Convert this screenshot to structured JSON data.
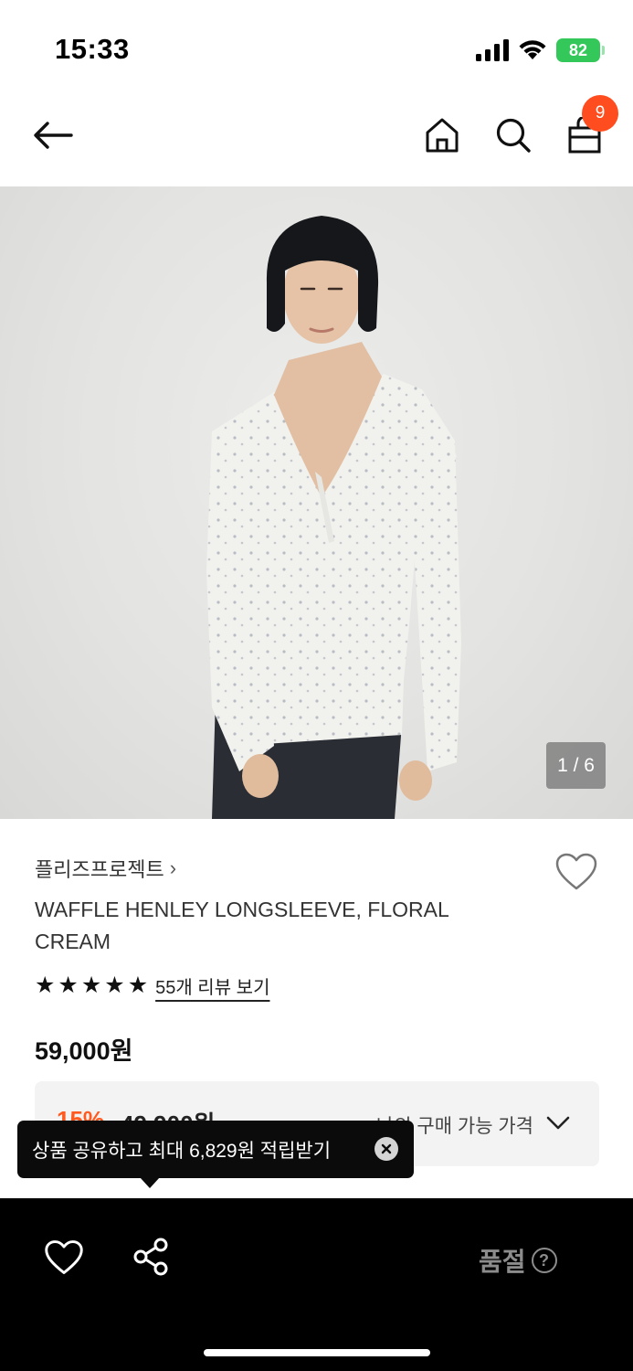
{
  "status_bar": {
    "time": "15:33",
    "battery": "82"
  },
  "nav": {
    "cart_count": "9"
  },
  "gallery": {
    "counter": "1 / 6"
  },
  "product": {
    "brand": "플리즈프로젝트",
    "brand_chevron": "›",
    "name": "WAFFLE HENLEY LONGSLEEVE, FLORAL CREAM",
    "rating_stars": 5,
    "review_link": "55개 리뷰 보기",
    "price": "59,000원"
  },
  "my_price": {
    "discount": "15%",
    "price": "49,900원",
    "label": "나의 구매 가능 가격"
  },
  "tooltip": {
    "text": "상품 공유하고 최대 6,829원 적립받기"
  },
  "bottom_bar": {
    "sold_out": "품절",
    "help": "?"
  },
  "icons": {
    "back": "arrow-left-icon",
    "home": "home-icon",
    "search": "search-icon",
    "cart": "shopping-bag-icon",
    "wishlist": "heart-icon",
    "share": "share-icon",
    "close": "close-icon",
    "help": "question-circle-icon"
  },
  "colors": {
    "accent": "#ff4d1f",
    "discount": "#ff5a1f",
    "battery": "#34c759"
  }
}
